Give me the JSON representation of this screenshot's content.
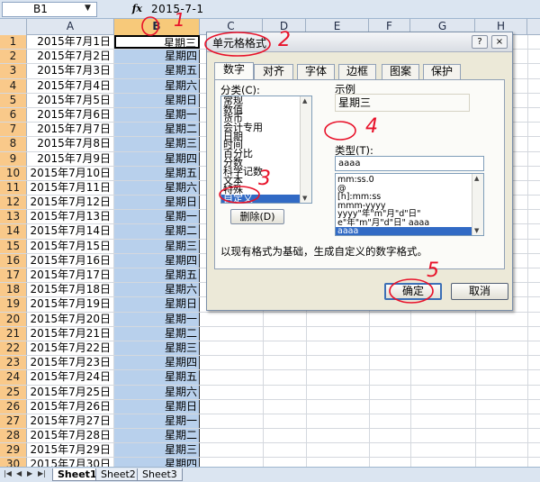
{
  "formula_bar": {
    "name_box": "B1",
    "fx": "fx",
    "value": "2015-7-1"
  },
  "columns": [
    "A",
    "B",
    "C",
    "D",
    "E",
    "F",
    "G",
    "H"
  ],
  "rows": [
    {
      "n": "1",
      "a": "2015年7月1日",
      "b": "星期三"
    },
    {
      "n": "2",
      "a": "2015年7月2日",
      "b": "星期四"
    },
    {
      "n": "3",
      "a": "2015年7月3日",
      "b": "星期五"
    },
    {
      "n": "4",
      "a": "2015年7月4日",
      "b": "星期六"
    },
    {
      "n": "5",
      "a": "2015年7月5日",
      "b": "星期日"
    },
    {
      "n": "6",
      "a": "2015年7月6日",
      "b": "星期一"
    },
    {
      "n": "7",
      "a": "2015年7月7日",
      "b": "星期二"
    },
    {
      "n": "8",
      "a": "2015年7月8日",
      "b": "星期三"
    },
    {
      "n": "9",
      "a": "2015年7月9日",
      "b": "星期四"
    },
    {
      "n": "10",
      "a": "2015年7月10日",
      "b": "星期五"
    },
    {
      "n": "11",
      "a": "2015年7月11日",
      "b": "星期六"
    },
    {
      "n": "12",
      "a": "2015年7月12日",
      "b": "星期日"
    },
    {
      "n": "13",
      "a": "2015年7月13日",
      "b": "星期一"
    },
    {
      "n": "14",
      "a": "2015年7月14日",
      "b": "星期二"
    },
    {
      "n": "15",
      "a": "2015年7月15日",
      "b": "星期三"
    },
    {
      "n": "16",
      "a": "2015年7月16日",
      "b": "星期四"
    },
    {
      "n": "17",
      "a": "2015年7月17日",
      "b": "星期五"
    },
    {
      "n": "18",
      "a": "2015年7月18日",
      "b": "星期六"
    },
    {
      "n": "19",
      "a": "2015年7月19日",
      "b": "星期日"
    },
    {
      "n": "20",
      "a": "2015年7月20日",
      "b": "星期一"
    },
    {
      "n": "21",
      "a": "2015年7月21日",
      "b": "星期二"
    },
    {
      "n": "22",
      "a": "2015年7月22日",
      "b": "星期三"
    },
    {
      "n": "23",
      "a": "2015年7月23日",
      "b": "星期四"
    },
    {
      "n": "24",
      "a": "2015年7月24日",
      "b": "星期五"
    },
    {
      "n": "25",
      "a": "2015年7月25日",
      "b": "星期六"
    },
    {
      "n": "26",
      "a": "2015年7月26日",
      "b": "星期日"
    },
    {
      "n": "27",
      "a": "2015年7月27日",
      "b": "星期一"
    },
    {
      "n": "28",
      "a": "2015年7月28日",
      "b": "星期二"
    },
    {
      "n": "29",
      "a": "2015年7月29日",
      "b": "星期三"
    },
    {
      "n": "30",
      "a": "2015年7月30日",
      "b": "星期四"
    }
  ],
  "sheet_tabs": [
    "Sheet1",
    "Sheet2",
    "Sheet3"
  ],
  "dialog": {
    "title": "单元格格式",
    "help": "?",
    "close": "×",
    "tabs": [
      "数字",
      "对齐",
      "字体",
      "边框",
      "图案",
      "保护"
    ],
    "category_label": "分类(C):",
    "categories": [
      "常规",
      "数值",
      "货币",
      "会计专用",
      "日期",
      "时间",
      "百分比",
      "分数",
      "科学记数",
      "文本",
      "特殊",
      "自定义"
    ],
    "selected_category": "自定义",
    "sample_label": "示例",
    "sample_value": "星期三",
    "type_label": "类型(T):",
    "type_value": "aaaa",
    "type_list": [
      "mm:ss.0",
      "@",
      "[h]:mm:ss",
      "mmm-yyyy",
      "yyyy\"年\"m\"月\"d\"日\"",
      "e\"年\"m\"月\"d\"日\" aaaa",
      "aaaa"
    ],
    "delete_button": "删除(D)",
    "description": "以现有格式为基础，生成自定义的数字格式。",
    "ok_button": "确定",
    "cancel_button": "取消"
  },
  "annotations": [
    "1",
    "2",
    "3",
    "4",
    "5"
  ],
  "colors": {
    "selection_fill": "#b8d0ec",
    "row_header": "#f9c98a",
    "annotation_ink": "#e8122a",
    "list_highlight": "#316ac5"
  }
}
